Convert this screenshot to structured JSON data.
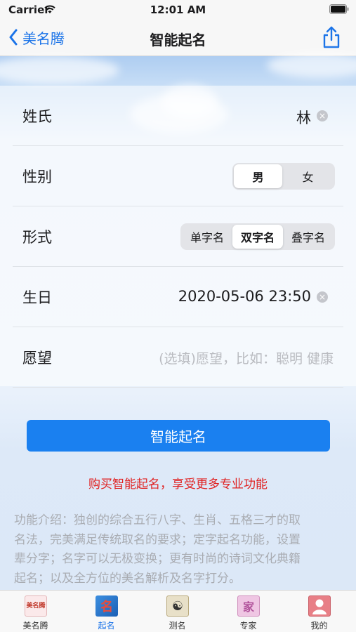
{
  "status": {
    "carrier": "Carrier",
    "time": "12:01 AM"
  },
  "nav": {
    "back_label": "美名腾",
    "title": "智能起名",
    "share_icon": "share-icon"
  },
  "form": {
    "surname": {
      "label": "姓氏",
      "value": "林"
    },
    "gender": {
      "label": "性别",
      "options": [
        "男",
        "女"
      ],
      "selected": "男"
    },
    "style": {
      "label": "形式",
      "options": [
        "单字名",
        "双字名",
        "叠字名"
      ],
      "selected": "双字名"
    },
    "birthday": {
      "label": "生日",
      "value": "2020-05-06 23:50"
    },
    "wish": {
      "label": "愿望",
      "placeholder": "(选填)愿望，比如：聪明 健康"
    }
  },
  "actions": {
    "primary_label": "智能起名",
    "promo": "购买智能起名，享受更多专业功能"
  },
  "intro": {
    "lines": [
      "功能介绍：独创的综合五行八字、生肖、五格三才的取",
      "名法，完美满足传统取名的要求；定字起名功能，设置",
      "辈分字；名字可以无极变换；更有时尚的诗词文化典籍",
      "起名；以及全方位的美名解析及名字打分。"
    ]
  },
  "tabs": [
    {
      "label": "美名腾",
      "icon": "app-logo-icon",
      "glyph": "美名腾"
    },
    {
      "label": "起名",
      "icon": "calligraphy-icon",
      "glyph": "名"
    },
    {
      "label": "测名",
      "icon": "yin-yang-icon",
      "glyph": "☯"
    },
    {
      "label": "专家",
      "icon": "seal-icon",
      "glyph": "家"
    },
    {
      "label": "我的",
      "icon": "user-icon",
      "glyph": ""
    }
  ],
  "active_tab": "起名",
  "colors": {
    "accent": "#1a80f0",
    "promo": "#e02020",
    "tab_active": "#1a73e8"
  }
}
